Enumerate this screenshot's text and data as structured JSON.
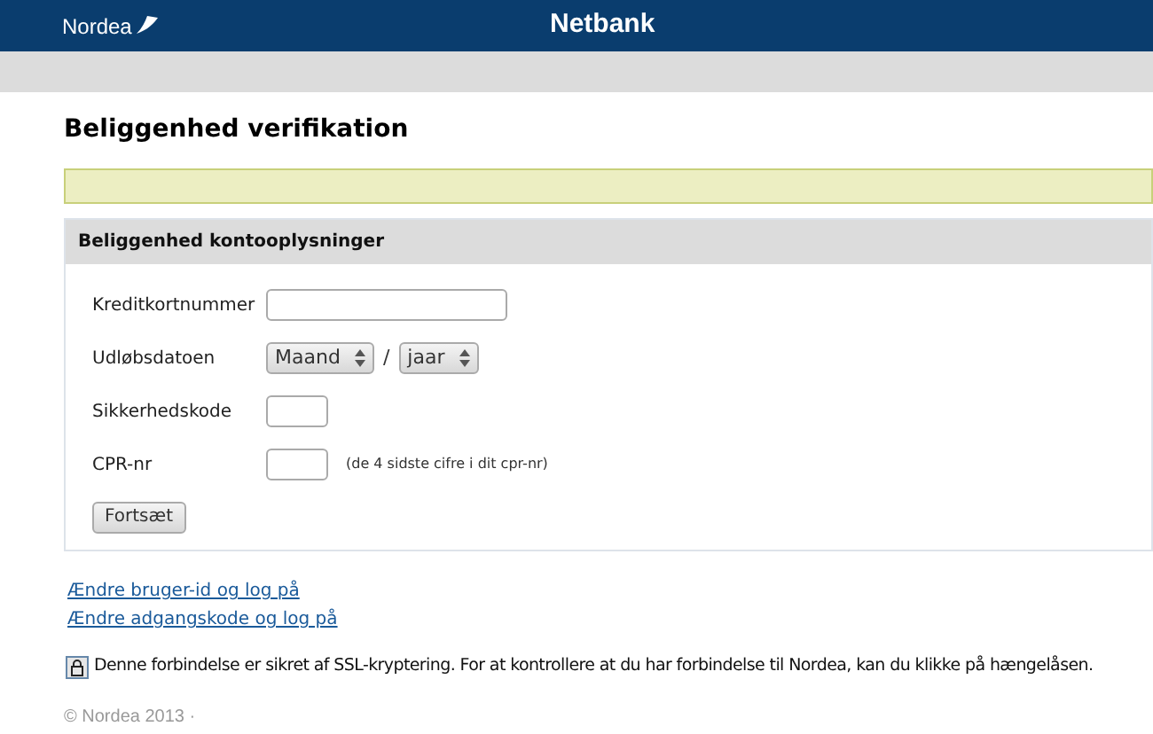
{
  "header": {
    "logo": "Nordea",
    "title": "Netbank"
  },
  "page_title": "Beliggenhed verifikation",
  "panel": {
    "title": "Beliggenhed kontooplysninger",
    "rows": [
      {
        "kind": "text",
        "label": "Kreditkortnummer"
      },
      {
        "kind": "date",
        "label": "Udløbsdatoen",
        "month": "Maand",
        "separator": "/",
        "year": "jaar"
      },
      {
        "kind": "short",
        "label": "Sikkerhedskode"
      },
      {
        "kind": "short",
        "label": "CPR-nr",
        "hint": "(de 4 sidste cifre i dit cpr-nr)"
      }
    ],
    "button": "Fortsæt"
  },
  "links": [
    "Ændre bruger-id og log på",
    "Ændre adgangskode og log på"
  ],
  "ssl_notice": "Denne forbindelse er sikret af SSL-kryptering. For at kontrollere at du har forbindelse til Nordea, kan du klikke på hængelåsen.",
  "footer": "© Nordea 2013 ·"
}
